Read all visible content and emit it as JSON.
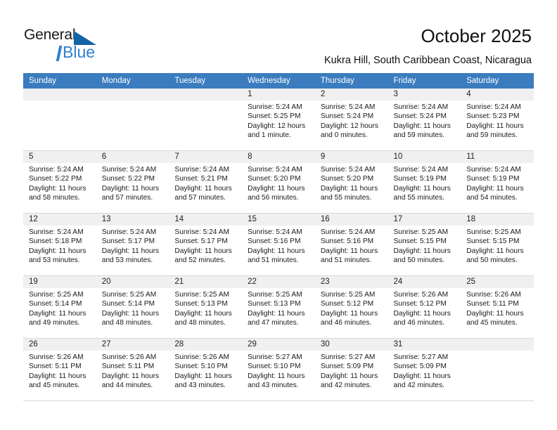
{
  "brand": {
    "name_top": "General",
    "name_bottom": "Blue",
    "accent_color": "#1464a5",
    "blue_text_color": "#2f7fd0"
  },
  "header": {
    "title": "October 2025",
    "subtitle": "Kukra Hill, South Caribbean Coast, Nicaragua"
  },
  "calendar": {
    "header_bg": "#3a7cbe",
    "daynum_bg": "#f0f0f0",
    "weekdays": [
      "Sunday",
      "Monday",
      "Tuesday",
      "Wednesday",
      "Thursday",
      "Friday",
      "Saturday"
    ],
    "weeks": [
      [
        {
          "day": "",
          "sunrise": "",
          "sunset": "",
          "daylight1": "",
          "daylight2": ""
        },
        {
          "day": "",
          "sunrise": "",
          "sunset": "",
          "daylight1": "",
          "daylight2": ""
        },
        {
          "day": "",
          "sunrise": "",
          "sunset": "",
          "daylight1": "",
          "daylight2": ""
        },
        {
          "day": "1",
          "sunrise": "Sunrise: 5:24 AM",
          "sunset": "Sunset: 5:25 PM",
          "daylight1": "Daylight: 12 hours",
          "daylight2": "and 1 minute."
        },
        {
          "day": "2",
          "sunrise": "Sunrise: 5:24 AM",
          "sunset": "Sunset: 5:24 PM",
          "daylight1": "Daylight: 12 hours",
          "daylight2": "and 0 minutes."
        },
        {
          "day": "3",
          "sunrise": "Sunrise: 5:24 AM",
          "sunset": "Sunset: 5:24 PM",
          "daylight1": "Daylight: 11 hours",
          "daylight2": "and 59 minutes."
        },
        {
          "day": "4",
          "sunrise": "Sunrise: 5:24 AM",
          "sunset": "Sunset: 5:23 PM",
          "daylight1": "Daylight: 11 hours",
          "daylight2": "and 59 minutes."
        }
      ],
      [
        {
          "day": "5",
          "sunrise": "Sunrise: 5:24 AM",
          "sunset": "Sunset: 5:22 PM",
          "daylight1": "Daylight: 11 hours",
          "daylight2": "and 58 minutes."
        },
        {
          "day": "6",
          "sunrise": "Sunrise: 5:24 AM",
          "sunset": "Sunset: 5:22 PM",
          "daylight1": "Daylight: 11 hours",
          "daylight2": "and 57 minutes."
        },
        {
          "day": "7",
          "sunrise": "Sunrise: 5:24 AM",
          "sunset": "Sunset: 5:21 PM",
          "daylight1": "Daylight: 11 hours",
          "daylight2": "and 57 minutes."
        },
        {
          "day": "8",
          "sunrise": "Sunrise: 5:24 AM",
          "sunset": "Sunset: 5:20 PM",
          "daylight1": "Daylight: 11 hours",
          "daylight2": "and 56 minutes."
        },
        {
          "day": "9",
          "sunrise": "Sunrise: 5:24 AM",
          "sunset": "Sunset: 5:20 PM",
          "daylight1": "Daylight: 11 hours",
          "daylight2": "and 55 minutes."
        },
        {
          "day": "10",
          "sunrise": "Sunrise: 5:24 AM",
          "sunset": "Sunset: 5:19 PM",
          "daylight1": "Daylight: 11 hours",
          "daylight2": "and 55 minutes."
        },
        {
          "day": "11",
          "sunrise": "Sunrise: 5:24 AM",
          "sunset": "Sunset: 5:19 PM",
          "daylight1": "Daylight: 11 hours",
          "daylight2": "and 54 minutes."
        }
      ],
      [
        {
          "day": "12",
          "sunrise": "Sunrise: 5:24 AM",
          "sunset": "Sunset: 5:18 PM",
          "daylight1": "Daylight: 11 hours",
          "daylight2": "and 53 minutes."
        },
        {
          "day": "13",
          "sunrise": "Sunrise: 5:24 AM",
          "sunset": "Sunset: 5:17 PM",
          "daylight1": "Daylight: 11 hours",
          "daylight2": "and 53 minutes."
        },
        {
          "day": "14",
          "sunrise": "Sunrise: 5:24 AM",
          "sunset": "Sunset: 5:17 PM",
          "daylight1": "Daylight: 11 hours",
          "daylight2": "and 52 minutes."
        },
        {
          "day": "15",
          "sunrise": "Sunrise: 5:24 AM",
          "sunset": "Sunset: 5:16 PM",
          "daylight1": "Daylight: 11 hours",
          "daylight2": "and 51 minutes."
        },
        {
          "day": "16",
          "sunrise": "Sunrise: 5:24 AM",
          "sunset": "Sunset: 5:16 PM",
          "daylight1": "Daylight: 11 hours",
          "daylight2": "and 51 minutes."
        },
        {
          "day": "17",
          "sunrise": "Sunrise: 5:25 AM",
          "sunset": "Sunset: 5:15 PM",
          "daylight1": "Daylight: 11 hours",
          "daylight2": "and 50 minutes."
        },
        {
          "day": "18",
          "sunrise": "Sunrise: 5:25 AM",
          "sunset": "Sunset: 5:15 PM",
          "daylight1": "Daylight: 11 hours",
          "daylight2": "and 50 minutes."
        }
      ],
      [
        {
          "day": "19",
          "sunrise": "Sunrise: 5:25 AM",
          "sunset": "Sunset: 5:14 PM",
          "daylight1": "Daylight: 11 hours",
          "daylight2": "and 49 minutes."
        },
        {
          "day": "20",
          "sunrise": "Sunrise: 5:25 AM",
          "sunset": "Sunset: 5:14 PM",
          "daylight1": "Daylight: 11 hours",
          "daylight2": "and 48 minutes."
        },
        {
          "day": "21",
          "sunrise": "Sunrise: 5:25 AM",
          "sunset": "Sunset: 5:13 PM",
          "daylight1": "Daylight: 11 hours",
          "daylight2": "and 48 minutes."
        },
        {
          "day": "22",
          "sunrise": "Sunrise: 5:25 AM",
          "sunset": "Sunset: 5:13 PM",
          "daylight1": "Daylight: 11 hours",
          "daylight2": "and 47 minutes."
        },
        {
          "day": "23",
          "sunrise": "Sunrise: 5:25 AM",
          "sunset": "Sunset: 5:12 PM",
          "daylight1": "Daylight: 11 hours",
          "daylight2": "and 46 minutes."
        },
        {
          "day": "24",
          "sunrise": "Sunrise: 5:26 AM",
          "sunset": "Sunset: 5:12 PM",
          "daylight1": "Daylight: 11 hours",
          "daylight2": "and 46 minutes."
        },
        {
          "day": "25",
          "sunrise": "Sunrise: 5:26 AM",
          "sunset": "Sunset: 5:11 PM",
          "daylight1": "Daylight: 11 hours",
          "daylight2": "and 45 minutes."
        }
      ],
      [
        {
          "day": "26",
          "sunrise": "Sunrise: 5:26 AM",
          "sunset": "Sunset: 5:11 PM",
          "daylight1": "Daylight: 11 hours",
          "daylight2": "and 45 minutes."
        },
        {
          "day": "27",
          "sunrise": "Sunrise: 5:26 AM",
          "sunset": "Sunset: 5:11 PM",
          "daylight1": "Daylight: 11 hours",
          "daylight2": "and 44 minutes."
        },
        {
          "day": "28",
          "sunrise": "Sunrise: 5:26 AM",
          "sunset": "Sunset: 5:10 PM",
          "daylight1": "Daylight: 11 hours",
          "daylight2": "and 43 minutes."
        },
        {
          "day": "29",
          "sunrise": "Sunrise: 5:27 AM",
          "sunset": "Sunset: 5:10 PM",
          "daylight1": "Daylight: 11 hours",
          "daylight2": "and 43 minutes."
        },
        {
          "day": "30",
          "sunrise": "Sunrise: 5:27 AM",
          "sunset": "Sunset: 5:09 PM",
          "daylight1": "Daylight: 11 hours",
          "daylight2": "and 42 minutes."
        },
        {
          "day": "31",
          "sunrise": "Sunrise: 5:27 AM",
          "sunset": "Sunset: 5:09 PM",
          "daylight1": "Daylight: 11 hours",
          "daylight2": "and 42 minutes."
        },
        {
          "day": "",
          "sunrise": "",
          "sunset": "",
          "daylight1": "",
          "daylight2": ""
        }
      ]
    ]
  }
}
